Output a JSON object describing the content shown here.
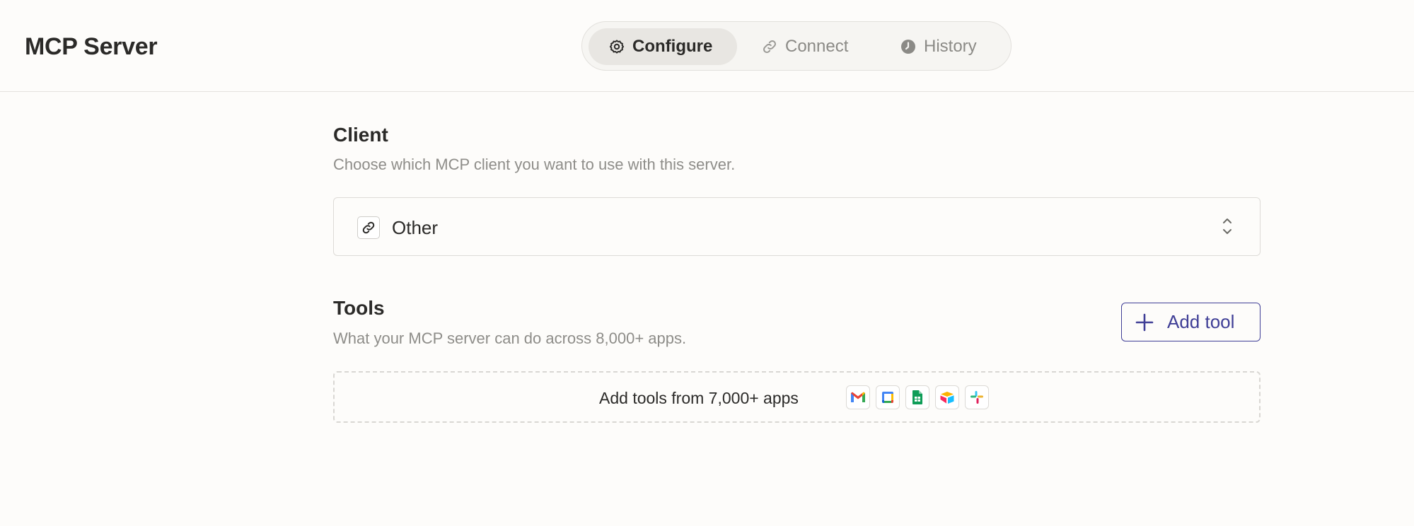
{
  "header": {
    "title": "MCP Server",
    "tabs": [
      {
        "label": "Configure",
        "icon": "gear-icon",
        "active": true
      },
      {
        "label": "Connect",
        "icon": "link-icon",
        "active": false
      },
      {
        "label": "History",
        "icon": "clock-icon",
        "active": false
      }
    ]
  },
  "client": {
    "title": "Client",
    "description": "Choose which MCP client you want to use with this server.",
    "selected_value": "Other",
    "selected_icon": "link-icon"
  },
  "tools": {
    "title": "Tools",
    "description": "What your MCP server can do across 8,000+ apps.",
    "add_button_label": "Add tool",
    "dropzone_text": "Add tools from 7,000+ apps",
    "app_icons": [
      "gmail-icon",
      "google-calendar-icon",
      "google-sheets-icon",
      "airtable-icon",
      "slack-icon"
    ]
  },
  "colors": {
    "accent": "#3f3e96",
    "background": "#fdfcfa",
    "muted_text": "#8e8d89"
  }
}
